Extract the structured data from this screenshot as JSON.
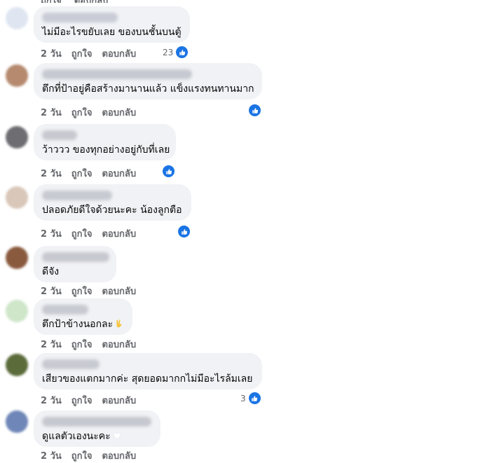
{
  "colors": {
    "bubble": "#f0f2f5",
    "action": "#65676b",
    "like": "#1b74e4"
  },
  "actions": {
    "like": "ถูกใจ",
    "reply": "ตอบกลับ"
  },
  "comments": [
    {
      "text": "ไม่มีอะไรขยับเลย ของบนชั้นบนตู้",
      "time": "2 วัน",
      "reactions": "23",
      "avatar_color": "#dfe6f1"
    },
    {
      "text": "ตึกที่ป้าอยู่คือสร้างมานานแล้ว แข็งแรงทนทานมาก",
      "time": "2 วัน",
      "reactions": "",
      "avatar_color": "#b58a6e"
    },
    {
      "text": "ว้าววว ของทุกอย่างอยู่กับที่เลย",
      "time": "2 วัน",
      "reactions": "",
      "avatar_color": "#6d6d72"
    },
    {
      "text": "ปลอดภัยดีใจด้วยนะคะ น้องลูกตือ",
      "time": "2 วัน",
      "reactions": "",
      "avatar_color": "#d9c7b9"
    },
    {
      "text": "ดีจัง",
      "time": "2 วัน",
      "reactions": "",
      "avatar_color": "#8a5a3e"
    },
    {
      "text": "ตึกป้าข้างนอกละ",
      "time": "2 วัน",
      "reactions": "",
      "avatar_color": "#cfe6c9",
      "emoji": "victory-hand"
    },
    {
      "text": "เสียวของแตกมากค่ะ สุดยอดมากกไม่มีอะไรล้มเลย",
      "time": "2 วัน",
      "reactions": "3",
      "avatar_color": "#5b6b3a"
    },
    {
      "text": "ดูแลตัวเองนะคะ",
      "time": "2 วัน",
      "reactions": "",
      "avatar_color": "#6f86b8",
      "emoji": "white-heart"
    }
  ]
}
